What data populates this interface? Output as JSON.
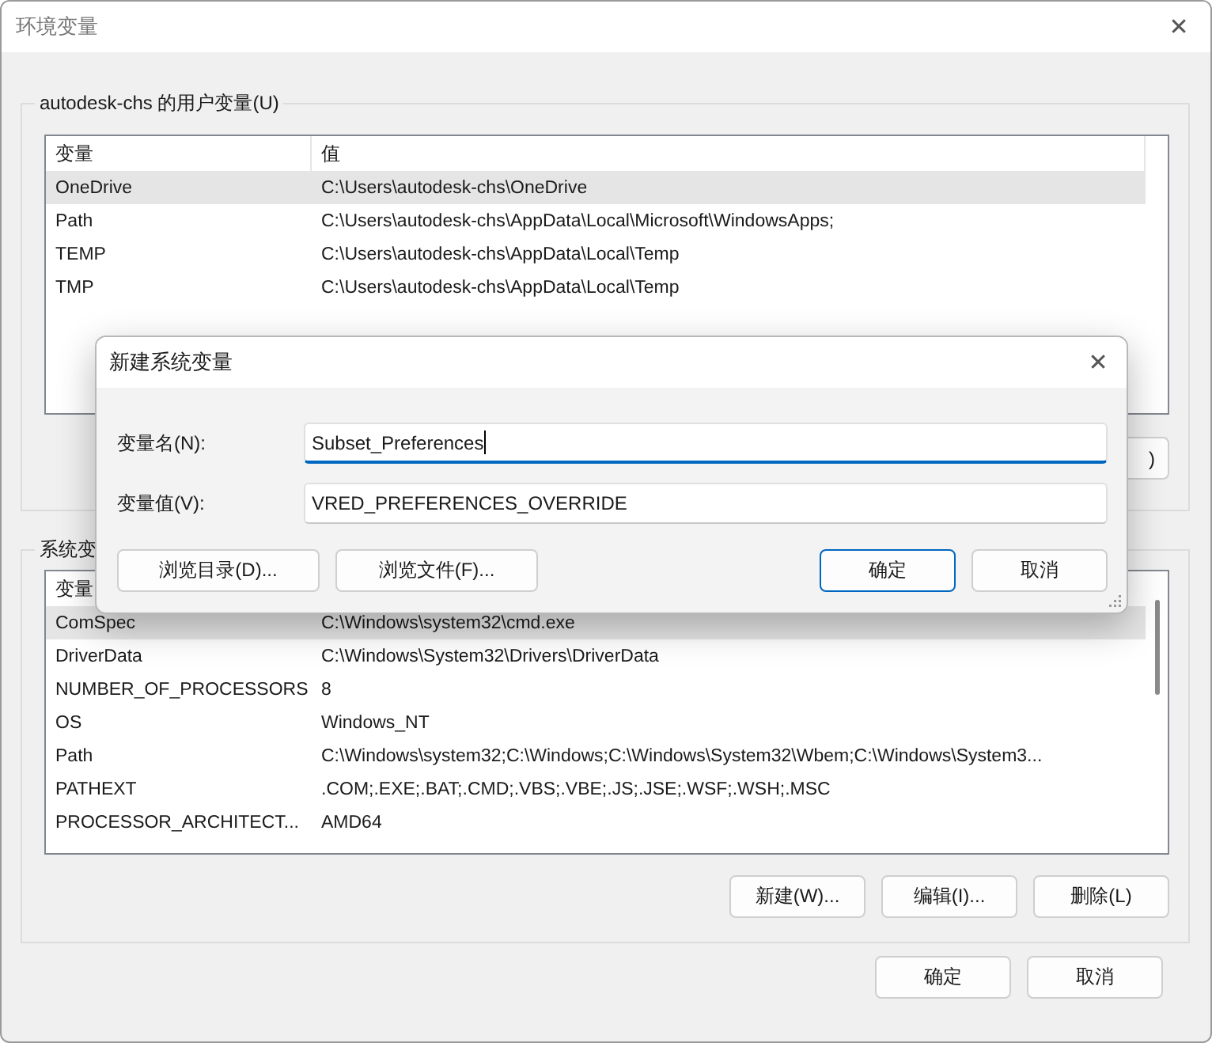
{
  "window": {
    "title": "环境变量",
    "close": "✕"
  },
  "user_group": {
    "label": "autodesk-chs 的用户变量(U)",
    "columns": [
      "变量",
      "值"
    ],
    "rows": [
      {
        "name": "OneDrive",
        "value": "C:\\Users\\autodesk-chs\\OneDrive",
        "selected": true
      },
      {
        "name": "Path",
        "value": "C:\\Users\\autodesk-chs\\AppData\\Local\\Microsoft\\WindowsApps;",
        "selected": false
      },
      {
        "name": "TEMP",
        "value": "C:\\Users\\autodesk-chs\\AppData\\Local\\Temp",
        "selected": false
      },
      {
        "name": "TMP",
        "value": "C:\\Users\\autodesk-chs\\AppData\\Local\\Temp",
        "selected": false
      }
    ],
    "buttons": [
      ")"
    ]
  },
  "system_group": {
    "label": "系统变",
    "columns": [
      "变量"
    ],
    "rows": [
      {
        "name": "ComSpec",
        "value": "C:\\Windows\\system32\\cmd.exe",
        "selected": true
      },
      {
        "name": "DriverData",
        "value": "C:\\Windows\\System32\\Drivers\\DriverData",
        "selected": false
      },
      {
        "name": "NUMBER_OF_PROCESSORS",
        "value": "8",
        "selected": false
      },
      {
        "name": "OS",
        "value": "Windows_NT",
        "selected": false
      },
      {
        "name": "Path",
        "value": "C:\\Windows\\system32;C:\\Windows;C:\\Windows\\System32\\Wbem;C:\\Windows\\System3...",
        "selected": false
      },
      {
        "name": "PATHEXT",
        "value": ".COM;.EXE;.BAT;.CMD;.VBS;.VBE;.JS;.JSE;.WSF;.WSH;.MSC",
        "selected": false
      },
      {
        "name": "PROCESSOR_ARCHITECT...",
        "value": "AMD64",
        "selected": false
      }
    ],
    "buttons": [
      "新建(W)...",
      "编辑(I)...",
      "删除(L)"
    ]
  },
  "buttons": [
    "确定",
    "取消"
  ],
  "dialog": {
    "title": "新建系统变量",
    "close": "✕",
    "fields": [
      {
        "label": "变量名(N):",
        "value": "Subset_Preferences",
        "focused": true
      },
      {
        "label": "变量值(V):",
        "value": "VRED_PREFERENCES_OVERRIDE",
        "focused": false
      }
    ],
    "left_buttons": [
      "浏览目录(D)...",
      "浏览文件(F)..."
    ],
    "buttons": [
      {
        "label": "确定",
        "default": true
      },
      {
        "label": "取消",
        "default": false
      }
    ]
  }
}
